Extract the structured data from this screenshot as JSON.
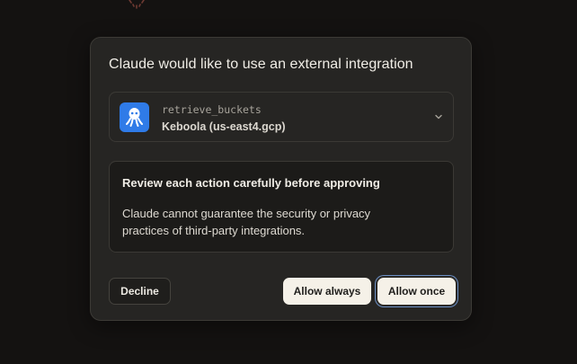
{
  "modal": {
    "title": "Claude would like to use an external integration"
  },
  "integration": {
    "tool_name": "retrieve_buckets",
    "server_name": "Keboola (us-east4.gcp)",
    "icon": "octopus-icon",
    "icon_color": "#2f7be8"
  },
  "warning": {
    "title": "Review each action carefully before approving",
    "body": "Claude cannot guarantee the security or privacy practices of third-party integrations."
  },
  "buttons": {
    "decline": "Decline",
    "allow_always": "Allow always",
    "allow_once": "Allow once"
  },
  "colors": {
    "background": "#141211",
    "modal": "#262523",
    "primary_button": "#f5f1e8"
  }
}
